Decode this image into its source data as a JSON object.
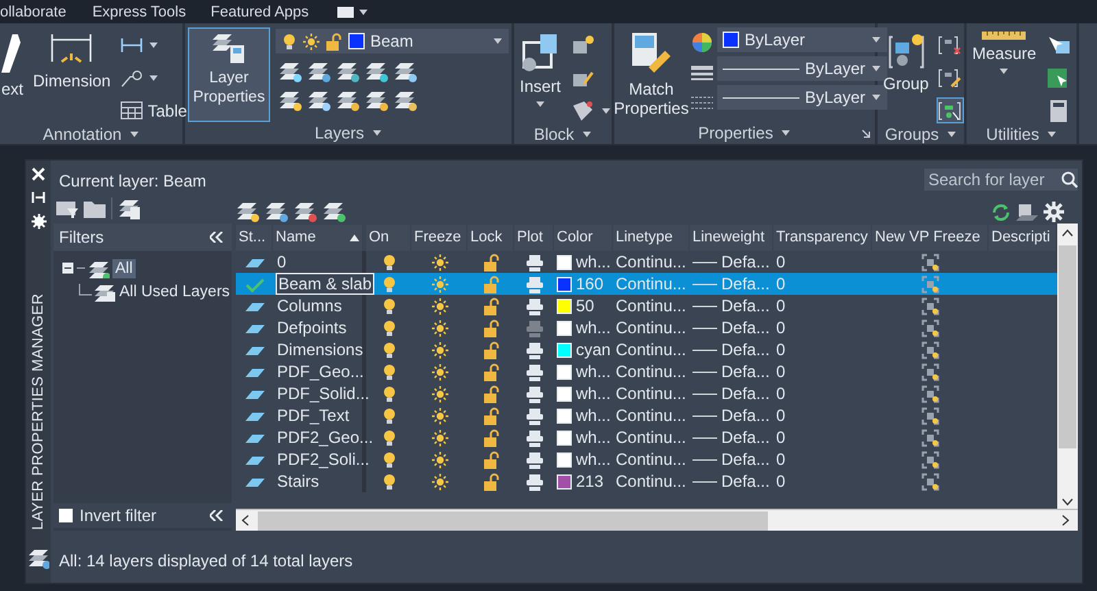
{
  "menu_tabs": [
    {
      "label": "ollaborate"
    },
    {
      "label": "Express Tools"
    },
    {
      "label": "Featured Apps"
    }
  ],
  "ribbon": {
    "annotation": {
      "title": "Annotation",
      "text_button": "ext",
      "dimension_button": "Dimension",
      "table_button": "Table"
    },
    "layers": {
      "title": "Layers",
      "layer_properties": {
        "label": "Layer Properties",
        "selected": true
      },
      "current_layer": "Beam"
    },
    "block": {
      "title": "Block",
      "insert_button": "Insert"
    },
    "properties": {
      "title": "Properties",
      "match_button": "Match Properties",
      "color_label": "ByLayer",
      "linetype": "ByLayer",
      "lineweight": "ByLayer"
    },
    "groups": {
      "title": "Groups",
      "group_button": "Group"
    },
    "utilities": {
      "title": "Utilities",
      "measure_button": "Measure"
    }
  },
  "palette": {
    "title": "LAYER PROPERTIES MANAGER",
    "current_layer": "Current layer: Beam",
    "search": {
      "placeholder": "Search for layer"
    },
    "filters": {
      "header": "Filters",
      "tree": [
        {
          "label": "All",
          "selected": true,
          "expanded": true,
          "children": [
            {
              "label": "All Used Layers",
              "selected": false
            }
          ]
        }
      ],
      "invert_filter": {
        "label": "Invert filter",
        "checked": false
      }
    },
    "table": {
      "columns": [
        {
          "label": "St...",
          "sorted": false
        },
        {
          "label": "Name",
          "sorted": true
        },
        {
          "label": "On",
          "sorted": false
        },
        {
          "label": "Freeze",
          "sorted": false
        },
        {
          "label": "Lock",
          "sorted": false
        },
        {
          "label": "Plot",
          "sorted": false
        },
        {
          "label": "Color",
          "sorted": false
        },
        {
          "label": "Linetype",
          "sorted": false
        },
        {
          "label": "Lineweight",
          "sorted": false
        },
        {
          "label": "Transparency",
          "sorted": false
        },
        {
          "label": "New VP Freeze",
          "sorted": false
        },
        {
          "label": "Descripti",
          "sorted": false
        }
      ],
      "rows": [
        {
          "kind": "layer",
          "name": "0",
          "selected": false,
          "on": true,
          "frozen": false,
          "locked": false,
          "plot": true,
          "color": "#ffffff",
          "color_name": "wh...",
          "linetype": "Continu...",
          "lineweight": "Defa...",
          "transparency": "0"
        },
        {
          "kind": "current",
          "name": "Beam & slab",
          "selected": true,
          "on": true,
          "frozen": false,
          "locked": false,
          "plot": true,
          "color": "#0a32ff",
          "color_name": "160",
          "linetype": "Continu...",
          "lineweight": "Defa...",
          "transparency": "0"
        },
        {
          "kind": "layer",
          "name": "Columns",
          "selected": false,
          "on": true,
          "frozen": false,
          "locked": false,
          "plot": true,
          "color": "#ffff00",
          "color_name": "50",
          "linetype": "Continu...",
          "lineweight": "Defa...",
          "transparency": "0"
        },
        {
          "kind": "layer",
          "name": "Defpoints",
          "selected": false,
          "on": true,
          "frozen": false,
          "locked": false,
          "plot": false,
          "color": "#ffffff",
          "color_name": "wh...",
          "linetype": "Continu...",
          "lineweight": "Defa...",
          "transparency": "0"
        },
        {
          "kind": "layer",
          "name": "Dimensions",
          "selected": false,
          "on": true,
          "frozen": false,
          "locked": false,
          "plot": true,
          "color": "#00ffff",
          "color_name": "cyan",
          "linetype": "Continu...",
          "lineweight": "Defa...",
          "transparency": "0"
        },
        {
          "kind": "layer",
          "name": "PDF_Geo...",
          "selected": false,
          "on": true,
          "frozen": false,
          "locked": false,
          "plot": true,
          "color": "#ffffff",
          "color_name": "wh...",
          "linetype": "Continu...",
          "lineweight": "Defa...",
          "transparency": "0"
        },
        {
          "kind": "layer",
          "name": "PDF_Solid...",
          "selected": false,
          "on": true,
          "frozen": false,
          "locked": false,
          "plot": true,
          "color": "#ffffff",
          "color_name": "wh...",
          "linetype": "Continu...",
          "lineweight": "Defa...",
          "transparency": "0"
        },
        {
          "kind": "layer",
          "name": "PDF_Text",
          "selected": false,
          "on": true,
          "frozen": false,
          "locked": false,
          "plot": true,
          "color": "#ffffff",
          "color_name": "wh...",
          "linetype": "Continu...",
          "lineweight": "Defa...",
          "transparency": "0"
        },
        {
          "kind": "layer",
          "name": "PDF2_Geo...",
          "selected": false,
          "on": true,
          "frozen": false,
          "locked": false,
          "plot": true,
          "color": "#ffffff",
          "color_name": "wh...",
          "linetype": "Continu...",
          "lineweight": "Defa...",
          "transparency": "0"
        },
        {
          "kind": "layer",
          "name": "PDF2_Soli...",
          "selected": false,
          "on": true,
          "frozen": false,
          "locked": false,
          "plot": true,
          "color": "#ffffff",
          "color_name": "wh...",
          "linetype": "Continu...",
          "lineweight": "Defa...",
          "transparency": "0"
        },
        {
          "kind": "layer",
          "name": "Stairs",
          "selected": false,
          "on": true,
          "frozen": false,
          "locked": false,
          "plot": true,
          "color": "#a24fa8",
          "color_name": "213",
          "linetype": "Continu...",
          "lineweight": "Defa...",
          "transparency": "0"
        }
      ]
    },
    "status": "All: 14 layers displayed of 14 total layers"
  }
}
